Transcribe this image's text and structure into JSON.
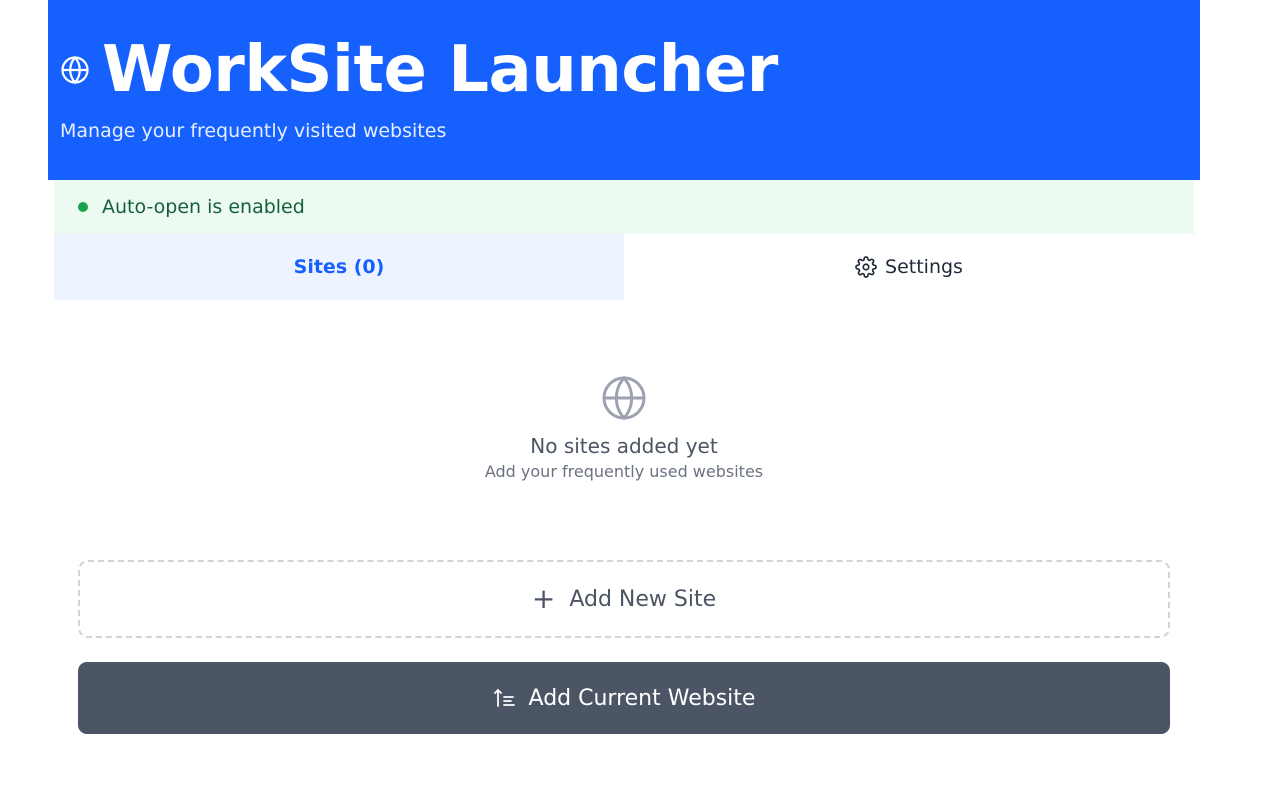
{
  "header": {
    "title": "WorkSite Launcher",
    "subtitle": "Manage your frequently visited websites",
    "icon": "globe-icon"
  },
  "status": {
    "text": "Auto-open is enabled",
    "color": "#16a34a"
  },
  "tabs": [
    {
      "label": "Sites (0)",
      "active": true
    },
    {
      "label": "Settings",
      "active": false,
      "icon": "gear-icon"
    }
  ],
  "empty_state": {
    "icon": "globe-icon",
    "title": "No sites added yet",
    "subtitle": "Add your frequently used websites"
  },
  "actions": {
    "add_new_label": "Add New Site",
    "add_new_icon": "plus-icon",
    "add_current_label": "Add Current Website",
    "add_current_icon": "add-current-icon"
  },
  "colors": {
    "brand": "#1660fe",
    "status_bg": "#edfaf1",
    "dark_button": "#4b5565"
  }
}
